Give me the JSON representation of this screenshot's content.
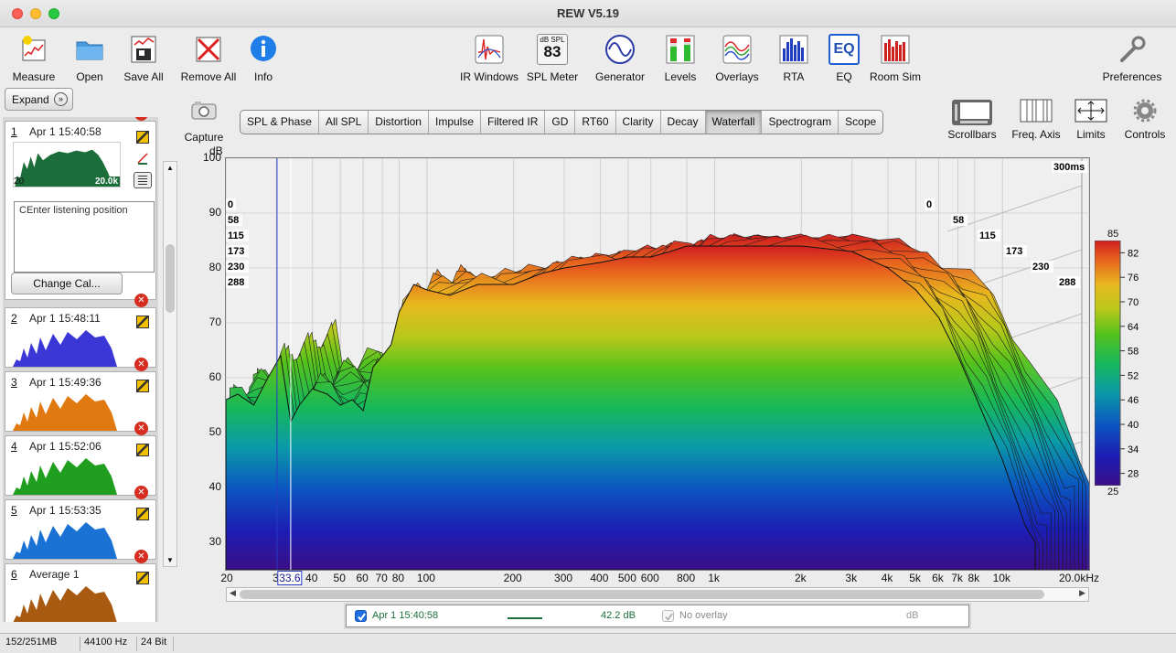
{
  "window": {
    "title": "REW V5.19"
  },
  "toolbar": {
    "left": [
      {
        "label": "Measure",
        "icon": "measure-icon"
      },
      {
        "label": "Open",
        "icon": "folder-icon"
      },
      {
        "label": "Save All",
        "icon": "save-icon"
      },
      {
        "label": "Remove All",
        "icon": "remove-all-icon"
      },
      {
        "label": "Info",
        "icon": "info-icon"
      }
    ],
    "center": [
      {
        "label": "IR Windows",
        "icon": "ir-windows-icon"
      },
      {
        "label": "SPL Meter",
        "icon": "spl-meter-icon",
        "badge_top": "dB SPL",
        "badge_value": "83"
      },
      {
        "label": "Generator",
        "icon": "generator-icon"
      },
      {
        "label": "Levels",
        "icon": "levels-icon"
      },
      {
        "label": "Overlays",
        "icon": "overlays-icon"
      },
      {
        "label": "RTA",
        "icon": "rta-icon"
      },
      {
        "label": "EQ",
        "icon": "eq-icon",
        "badge_value": "EQ"
      },
      {
        "label": "Room Sim",
        "icon": "room-sim-icon"
      }
    ],
    "preferences": {
      "label": "Preferences",
      "icon": "wrench-icon"
    }
  },
  "left_panel": {
    "expand_label": "Expand",
    "measurements": [
      {
        "num": "1",
        "date": "Apr 1 15:40:58",
        "color": "#1b6e3a",
        "thumb_min": "20",
        "thumb_max": "20.0k"
      },
      {
        "num": "2",
        "date": "Apr 1 15:48:11",
        "color": "#3b36d6"
      },
      {
        "num": "3",
        "date": "Apr 1 15:49:36",
        "color": "#e07a10"
      },
      {
        "num": "4",
        "date": "Apr 1 15:52:06",
        "color": "#1f9e1f"
      },
      {
        "num": "5",
        "date": "Apr 1 15:53:35",
        "color": "#1a72d4"
      },
      {
        "num": "6",
        "date": "Average 1",
        "color": "#a85a10"
      }
    ],
    "notes": "CEnter listening position",
    "change_cal_label": "Change Cal..."
  },
  "capture_label": "Capture",
  "graph_tabs": {
    "items": [
      "SPL & Phase",
      "All SPL",
      "Distortion",
      "Impulse",
      "Filtered IR",
      "GD",
      "RT60",
      "Clarity",
      "Decay",
      "Waterfall",
      "Spectrogram",
      "Scope"
    ],
    "active": "Waterfall"
  },
  "graph_controls": [
    {
      "label": "Scrollbars",
      "icon": "scrollbars-icon"
    },
    {
      "label": "Freq. Axis",
      "icon": "freq-axis-icon"
    },
    {
      "label": "Limits",
      "icon": "limits-icon"
    },
    {
      "label": "Controls",
      "icon": "gear-icon"
    }
  ],
  "chart_data": {
    "type": "area",
    "subtype": "waterfall-3d",
    "ylabel": "dB",
    "y_ticks": [
      "100",
      "90",
      "80",
      "70",
      "60",
      "50",
      "40",
      "30"
    ],
    "ylim": [
      25,
      100
    ],
    "x_scale": "log",
    "x_ticks": [
      "20",
      "3",
      "40",
      "50",
      "60",
      "70",
      "80",
      "100",
      "200",
      "300",
      "400",
      "500",
      "600",
      "800",
      "1k",
      "2k",
      "3k",
      "4k",
      "5k",
      "6k",
      "7k",
      "8k",
      "10k",
      "20.0kHz"
    ],
    "x_tick_values": [
      20,
      30,
      40,
      50,
      60,
      70,
      80,
      100,
      200,
      300,
      400,
      500,
      600,
      800,
      1000,
      2000,
      3000,
      4000,
      5000,
      6000,
      7000,
      8000,
      10000,
      20000
    ],
    "cursor_freq": "33.6",
    "cursor_freq_value": 33.6,
    "time_axis_label": "300ms",
    "time_slices_ms": [
      "0",
      "58",
      "115",
      "173",
      "230",
      "288"
    ],
    "colorbar": {
      "min": "25",
      "max": "85",
      "ticks": [
        "82",
        "76",
        "70",
        "64",
        "58",
        "52",
        "46",
        "40",
        "34",
        "28"
      ]
    },
    "front_slice": {
      "x": [
        20,
        22,
        25,
        28,
        31,
        33.6,
        36,
        40,
        45,
        50,
        55,
        60,
        65,
        70,
        75,
        80,
        90,
        100,
        120,
        150,
        200,
        250,
        300,
        400,
        500,
        600,
        700,
        800,
        1000,
        1500,
        2000,
        3000,
        4000,
        5000,
        6000,
        7000,
        8000,
        10000,
        12000,
        13000
      ],
      "y": [
        56,
        57,
        55,
        60,
        64,
        52,
        55,
        58,
        57,
        55,
        56,
        54,
        62,
        64,
        66,
        72,
        77,
        76,
        75,
        77,
        77,
        79,
        80,
        81,
        82,
        82,
        83,
        84,
        84,
        84,
        84,
        83,
        80,
        76,
        71,
        64,
        57,
        45,
        33,
        30
      ]
    }
  },
  "legend": {
    "name": "Apr 1 15:40:58",
    "value": "42.2 dB",
    "overlay_label": "No overlay",
    "unit": "dB",
    "color": "#1b6e3a"
  },
  "status": {
    "memory": "152/251MB",
    "sample_rate": "44100 Hz",
    "bit_depth": "24 Bit"
  }
}
